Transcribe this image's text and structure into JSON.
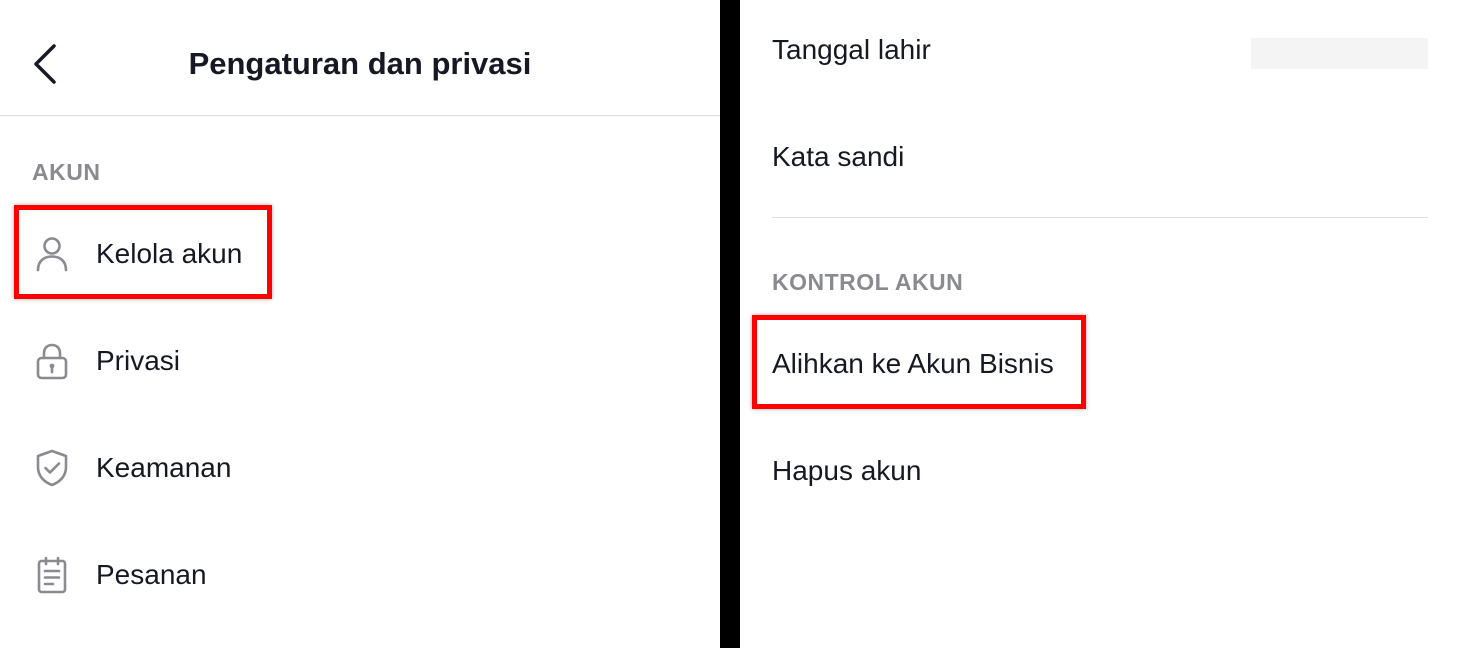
{
  "left_panel": {
    "title": "Pengaturan dan privasi",
    "section_label": "AKUN",
    "items": [
      {
        "label": "Kelola akun",
        "icon": "person-icon",
        "highlighted": true
      },
      {
        "label": "Privasi",
        "icon": "lock-icon",
        "highlighted": false
      },
      {
        "label": "Keamanan",
        "icon": "shield-check-icon",
        "highlighted": false
      },
      {
        "label": "Pesanan",
        "icon": "clipboard-list-icon",
        "highlighted": false
      }
    ]
  },
  "right_panel": {
    "items_top": [
      {
        "label": "Tanggal lahir",
        "value": ""
      },
      {
        "label": "Kata sandi"
      }
    ],
    "section_label": "KONTROL AKUN",
    "items_bottom": [
      {
        "label": "Alihkan ke Akun Bisnis",
        "highlighted": true
      },
      {
        "label": "Hapus akun",
        "highlighted": false
      }
    ]
  },
  "colors": {
    "highlight": "#ff0000",
    "divider": "#000000",
    "section_label": "#8a8b91",
    "text": "#161823",
    "icon": "#8a8b91"
  }
}
